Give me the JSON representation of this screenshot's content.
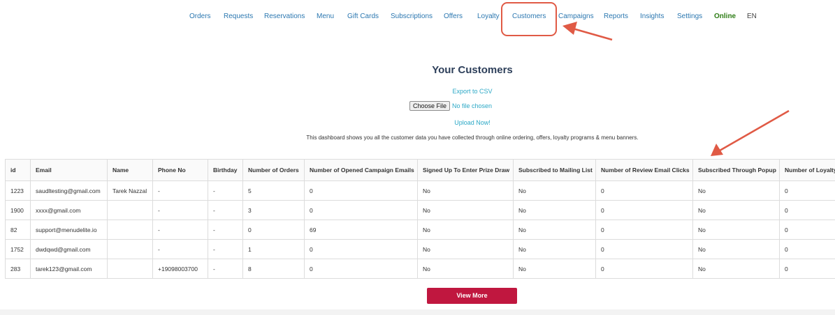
{
  "nav": {
    "items": [
      {
        "label": "Orders"
      },
      {
        "label": "Requests"
      },
      {
        "label": "Reservations"
      },
      {
        "label": "Menu"
      },
      {
        "label": "Gift Cards"
      },
      {
        "label": "Subscriptions"
      },
      {
        "label": "Offers"
      },
      {
        "label": "Loyalty"
      },
      {
        "label": "Customers"
      },
      {
        "label": "Campaigns"
      },
      {
        "label": "Reports"
      },
      {
        "label": "Insights"
      },
      {
        "label": "Settings"
      }
    ],
    "status": "Online",
    "language": "EN"
  },
  "page": {
    "title": "Your Customers",
    "export_link": "Export to CSV",
    "file_button": "Choose File",
    "file_status": "No file chosen",
    "upload_link": "Upload Now!",
    "description": "This dashboard shows you all the customer data you have collected through online ordering, offers, loyalty programs & menu banners."
  },
  "table": {
    "headers": [
      "id",
      "Email",
      "Name",
      "Phone No",
      "Birthday",
      "Number of Orders",
      "Number of Opened Campaign Emails",
      "Signed Up To Enter Prize Draw",
      "Subscribed to Mailing List",
      "Number of Review Email Clicks",
      "Subscribed Through Popup",
      "Number of Loyalty"
    ],
    "rows": [
      [
        "1223",
        "saudltesting@gmail.com",
        "Tarek Nazzal",
        "-",
        "-",
        "5",
        "0",
        "No",
        "No",
        "0",
        "No",
        "0"
      ],
      [
        "1900",
        "xxxx@gmail.com",
        "",
        "-",
        "-",
        "3",
        "0",
        "No",
        "No",
        "0",
        "No",
        "0"
      ],
      [
        "82",
        "support@menudelite.io",
        "",
        "-",
        "-",
        "0",
        "69",
        "No",
        "No",
        "0",
        "No",
        "0"
      ],
      [
        "1752",
        "dwdqwd@gmail.com",
        "",
        "-",
        "-",
        "1",
        "0",
        "No",
        "No",
        "0",
        "No",
        "0"
      ],
      [
        "283",
        "tarek123@gmail.com",
        "",
        "+19098003700",
        "-",
        "8",
        "0",
        "No",
        "No",
        "0",
        "No",
        "0"
      ]
    ]
  },
  "actions": {
    "view_more": "View More"
  },
  "colors": {
    "nav_link": "#2b77b0",
    "online": "#2e7d16",
    "accent_link": "#2ba8c6",
    "primary_button": "#c0173f",
    "annotation": "#e05a45"
  }
}
